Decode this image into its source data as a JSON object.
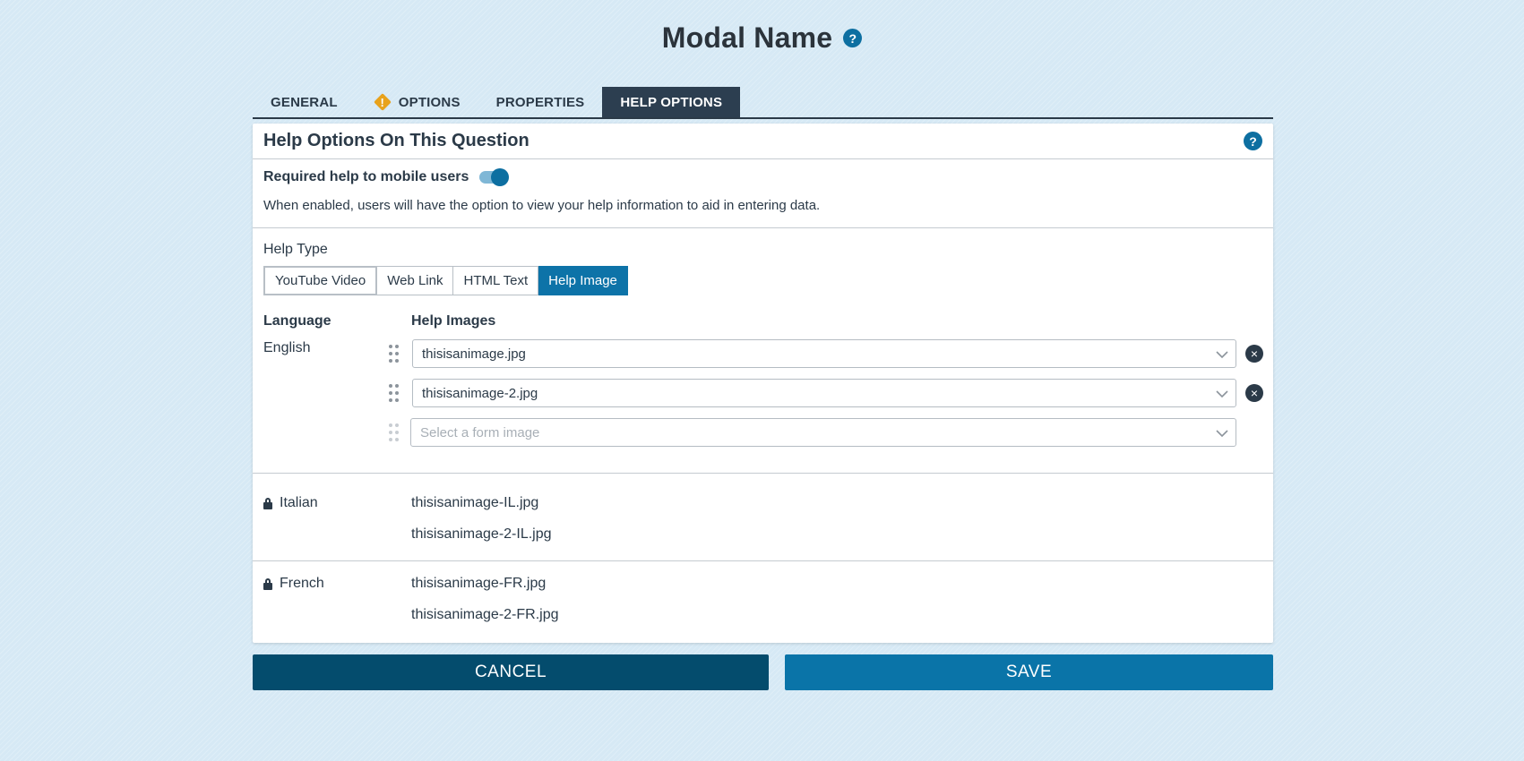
{
  "modal": {
    "title": "Modal Name",
    "help_glyph": "?"
  },
  "tabs": [
    {
      "label": "GENERAL",
      "active": false
    },
    {
      "label": "OPTIONS",
      "active": false,
      "icon": "warning-icon"
    },
    {
      "label": "PROPERTIES",
      "active": false
    },
    {
      "label": "HELP OPTIONS",
      "active": true
    }
  ],
  "card": {
    "title": "Help Options On This Question",
    "help_glyph": "?"
  },
  "mobile_help": {
    "label": "Required help to mobile users",
    "enabled": true,
    "description": "When enabled, users will have the option to view your help information to aid in entering data."
  },
  "help_type": {
    "label": "Help Type",
    "options": [
      "YouTube Video",
      "Web Link",
      "HTML Text",
      "Help Image"
    ],
    "selected": "Help Image"
  },
  "columns": {
    "language": "Language",
    "help_images": "Help Images"
  },
  "english": {
    "language": "English",
    "images": [
      "thisisanimage.jpg",
      "thisisanimage-2.jpg"
    ],
    "new_placeholder": "Select a form image",
    "remove_glyph": "×"
  },
  "locked_languages": [
    {
      "language": "Italian",
      "images": [
        "thisisanimage-IL.jpg",
        "thisisanimage-2-IL.jpg"
      ]
    },
    {
      "language": "French",
      "images": [
        "thisisanimage-FR.jpg",
        "thisisanimage-2-FR.jpg"
      ]
    }
  ],
  "footer": {
    "cancel_label": "CANCEL",
    "save_label": "SAVE"
  },
  "colors": {
    "primary": "#0d73a8",
    "dark_navy": "#2c3e50",
    "cancel": "#044c6d",
    "warning": "#e8a21b"
  }
}
